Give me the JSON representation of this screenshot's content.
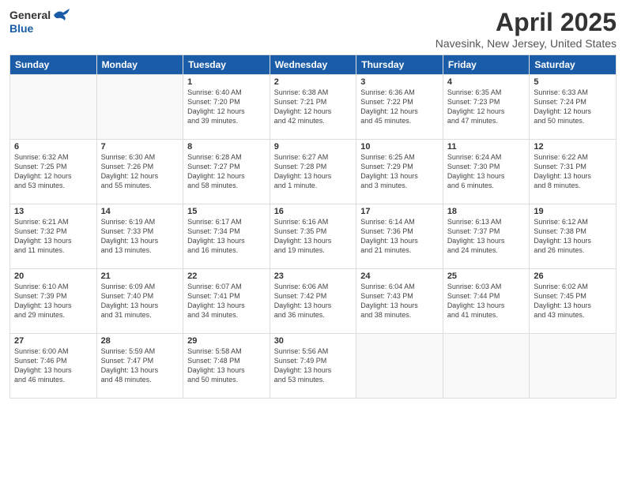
{
  "header": {
    "logo_general": "General",
    "logo_blue": "Blue",
    "title": "April 2025",
    "location": "Navesink, New Jersey, United States"
  },
  "days_of_week": [
    "Sunday",
    "Monday",
    "Tuesday",
    "Wednesday",
    "Thursday",
    "Friday",
    "Saturday"
  ],
  "weeks": [
    [
      {
        "day": "",
        "info": ""
      },
      {
        "day": "",
        "info": ""
      },
      {
        "day": "1",
        "info": "Sunrise: 6:40 AM\nSunset: 7:20 PM\nDaylight: 12 hours\nand 39 minutes."
      },
      {
        "day": "2",
        "info": "Sunrise: 6:38 AM\nSunset: 7:21 PM\nDaylight: 12 hours\nand 42 minutes."
      },
      {
        "day": "3",
        "info": "Sunrise: 6:36 AM\nSunset: 7:22 PM\nDaylight: 12 hours\nand 45 minutes."
      },
      {
        "day": "4",
        "info": "Sunrise: 6:35 AM\nSunset: 7:23 PM\nDaylight: 12 hours\nand 47 minutes."
      },
      {
        "day": "5",
        "info": "Sunrise: 6:33 AM\nSunset: 7:24 PM\nDaylight: 12 hours\nand 50 minutes."
      }
    ],
    [
      {
        "day": "6",
        "info": "Sunrise: 6:32 AM\nSunset: 7:25 PM\nDaylight: 12 hours\nand 53 minutes."
      },
      {
        "day": "7",
        "info": "Sunrise: 6:30 AM\nSunset: 7:26 PM\nDaylight: 12 hours\nand 55 minutes."
      },
      {
        "day": "8",
        "info": "Sunrise: 6:28 AM\nSunset: 7:27 PM\nDaylight: 12 hours\nand 58 minutes."
      },
      {
        "day": "9",
        "info": "Sunrise: 6:27 AM\nSunset: 7:28 PM\nDaylight: 13 hours\nand 1 minute."
      },
      {
        "day": "10",
        "info": "Sunrise: 6:25 AM\nSunset: 7:29 PM\nDaylight: 13 hours\nand 3 minutes."
      },
      {
        "day": "11",
        "info": "Sunrise: 6:24 AM\nSunset: 7:30 PM\nDaylight: 13 hours\nand 6 minutes."
      },
      {
        "day": "12",
        "info": "Sunrise: 6:22 AM\nSunset: 7:31 PM\nDaylight: 13 hours\nand 8 minutes."
      }
    ],
    [
      {
        "day": "13",
        "info": "Sunrise: 6:21 AM\nSunset: 7:32 PM\nDaylight: 13 hours\nand 11 minutes."
      },
      {
        "day": "14",
        "info": "Sunrise: 6:19 AM\nSunset: 7:33 PM\nDaylight: 13 hours\nand 13 minutes."
      },
      {
        "day": "15",
        "info": "Sunrise: 6:17 AM\nSunset: 7:34 PM\nDaylight: 13 hours\nand 16 minutes."
      },
      {
        "day": "16",
        "info": "Sunrise: 6:16 AM\nSunset: 7:35 PM\nDaylight: 13 hours\nand 19 minutes."
      },
      {
        "day": "17",
        "info": "Sunrise: 6:14 AM\nSunset: 7:36 PM\nDaylight: 13 hours\nand 21 minutes."
      },
      {
        "day": "18",
        "info": "Sunrise: 6:13 AM\nSunset: 7:37 PM\nDaylight: 13 hours\nand 24 minutes."
      },
      {
        "day": "19",
        "info": "Sunrise: 6:12 AM\nSunset: 7:38 PM\nDaylight: 13 hours\nand 26 minutes."
      }
    ],
    [
      {
        "day": "20",
        "info": "Sunrise: 6:10 AM\nSunset: 7:39 PM\nDaylight: 13 hours\nand 29 minutes."
      },
      {
        "day": "21",
        "info": "Sunrise: 6:09 AM\nSunset: 7:40 PM\nDaylight: 13 hours\nand 31 minutes."
      },
      {
        "day": "22",
        "info": "Sunrise: 6:07 AM\nSunset: 7:41 PM\nDaylight: 13 hours\nand 34 minutes."
      },
      {
        "day": "23",
        "info": "Sunrise: 6:06 AM\nSunset: 7:42 PM\nDaylight: 13 hours\nand 36 minutes."
      },
      {
        "day": "24",
        "info": "Sunrise: 6:04 AM\nSunset: 7:43 PM\nDaylight: 13 hours\nand 38 minutes."
      },
      {
        "day": "25",
        "info": "Sunrise: 6:03 AM\nSunset: 7:44 PM\nDaylight: 13 hours\nand 41 minutes."
      },
      {
        "day": "26",
        "info": "Sunrise: 6:02 AM\nSunset: 7:45 PM\nDaylight: 13 hours\nand 43 minutes."
      }
    ],
    [
      {
        "day": "27",
        "info": "Sunrise: 6:00 AM\nSunset: 7:46 PM\nDaylight: 13 hours\nand 46 minutes."
      },
      {
        "day": "28",
        "info": "Sunrise: 5:59 AM\nSunset: 7:47 PM\nDaylight: 13 hours\nand 48 minutes."
      },
      {
        "day": "29",
        "info": "Sunrise: 5:58 AM\nSunset: 7:48 PM\nDaylight: 13 hours\nand 50 minutes."
      },
      {
        "day": "30",
        "info": "Sunrise: 5:56 AM\nSunset: 7:49 PM\nDaylight: 13 hours\nand 53 minutes."
      },
      {
        "day": "",
        "info": ""
      },
      {
        "day": "",
        "info": ""
      },
      {
        "day": "",
        "info": ""
      }
    ]
  ]
}
